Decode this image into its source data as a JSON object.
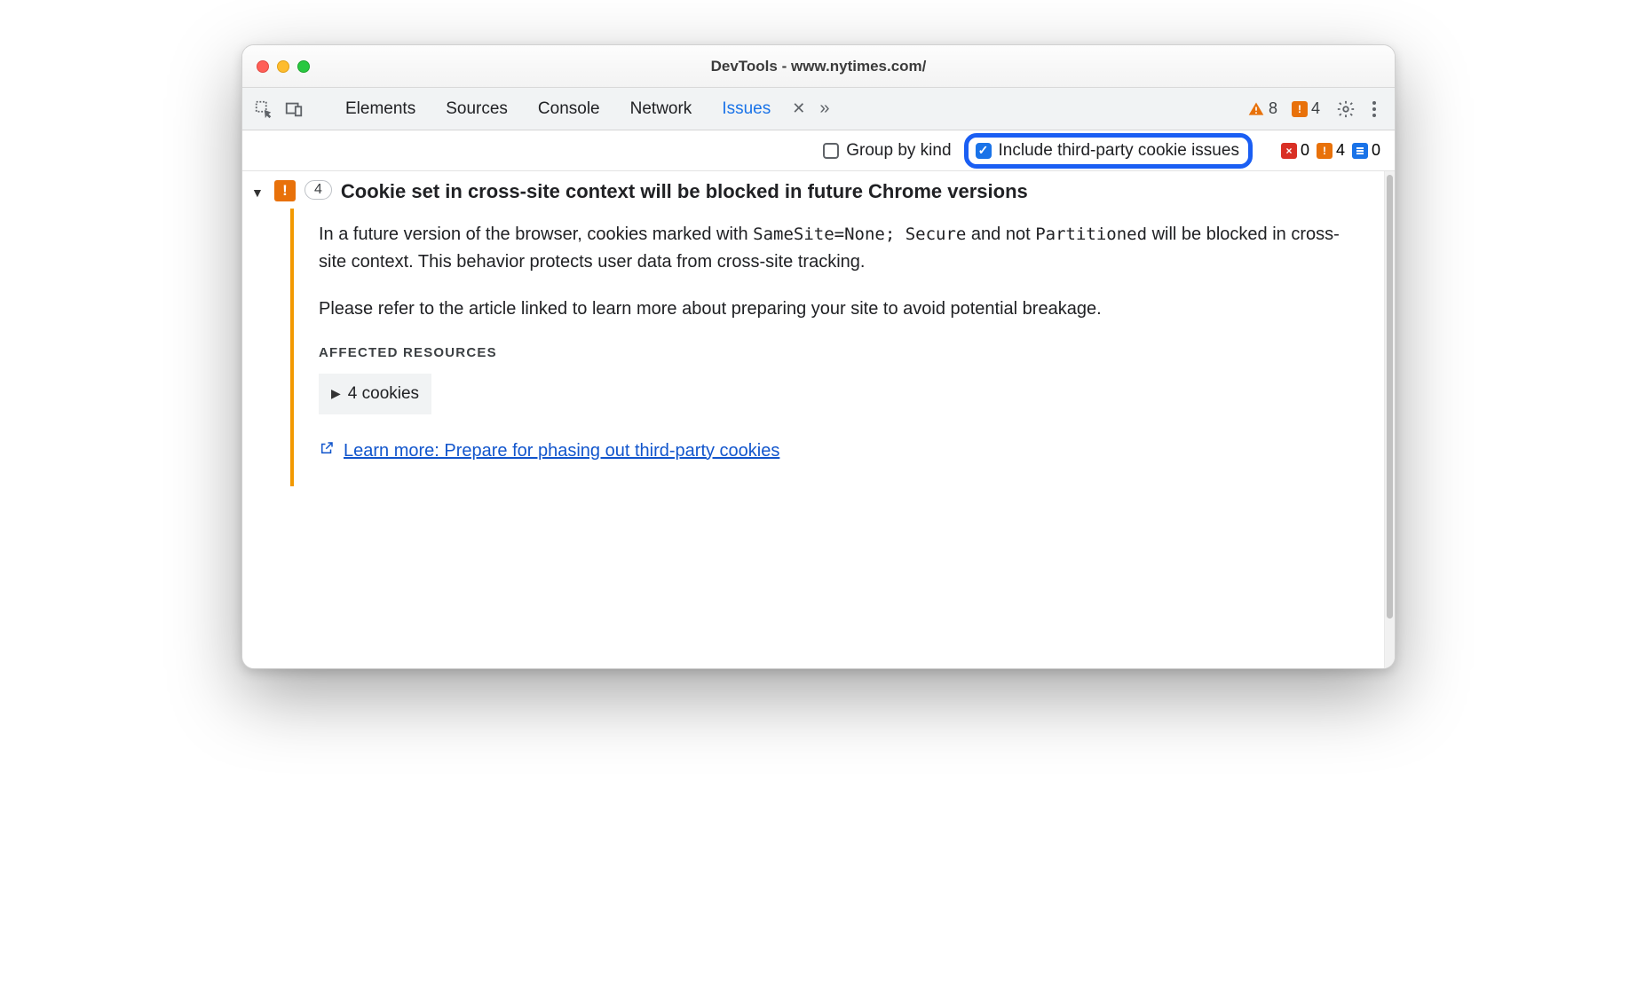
{
  "window": {
    "title": "DevTools - www.nytimes.com/"
  },
  "tabs": {
    "elements": "Elements",
    "sources": "Sources",
    "console": "Console",
    "network": "Network",
    "issues": "Issues"
  },
  "topCounts": {
    "warnings": "8",
    "errors": "4"
  },
  "toolbar": {
    "groupByKind": "Group by kind",
    "includeThirdParty": "Include third-party cookie issues",
    "miniRed": "0",
    "miniOrange": "4",
    "miniBlue": "0"
  },
  "issue": {
    "count": "4",
    "title": "Cookie set in cross-site context will be blocked in future Chrome versions",
    "body_prefix": "In a future version of the browser, cookies marked with ",
    "code1": "SameSite=None; Secure",
    "body_mid": " and not ",
    "code2": "Partitioned",
    "body_suffix": " will be blocked in cross-site context. This behavior protects user data from cross-site tracking.",
    "para2": "Please refer to the article linked to learn more about preparing your site to avoid potential breakage.",
    "affected_header": "AFFECTED RESOURCES",
    "cookies_label": "4 cookies",
    "learn_more": "Learn more: Prepare for phasing out third-party cookies"
  }
}
